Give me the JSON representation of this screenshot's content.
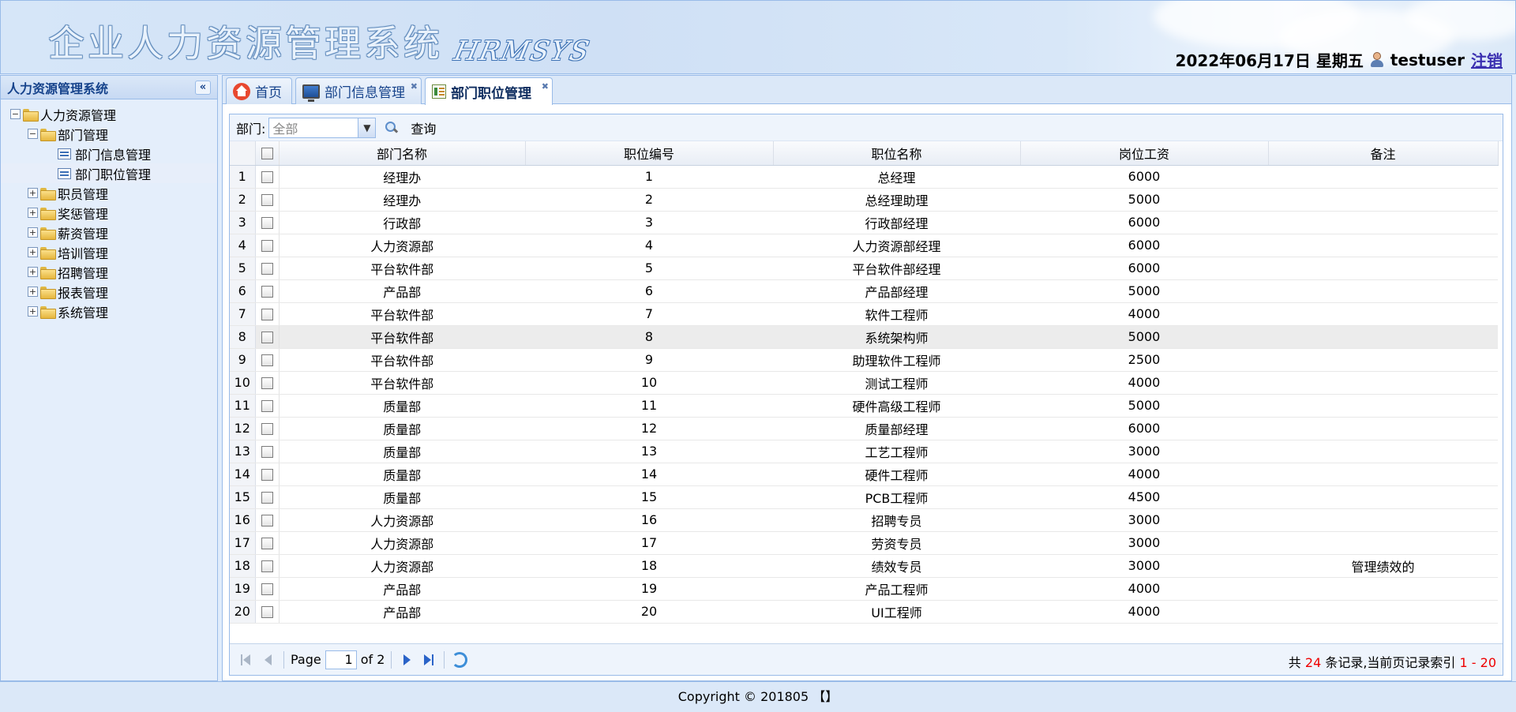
{
  "header": {
    "system_title": "企业人力资源管理系统",
    "system_subtitle": "HRMSYS",
    "date_text": "2022年06月17日 星期五",
    "username": "testuser",
    "logout_label": "注销",
    "user_icon": "user-icon"
  },
  "sidebar": {
    "title": "人力资源管理系统",
    "collapse_icon": "double-chevron-left-icon",
    "root": "人力资源管理",
    "items": [
      {
        "label": "部门管理",
        "expanded": true
      },
      {
        "label": "部门信息管理",
        "child": true
      },
      {
        "label": "部门职位管理",
        "child": true,
        "selected": true
      },
      {
        "label": "职员管理"
      },
      {
        "label": "奖惩管理"
      },
      {
        "label": "薪资管理"
      },
      {
        "label": "培训管理"
      },
      {
        "label": "招聘管理"
      },
      {
        "label": "报表管理"
      },
      {
        "label": "系统管理"
      }
    ]
  },
  "tabs": [
    {
      "label": "首页",
      "icon": "home-icon",
      "closable": false
    },
    {
      "label": "部门信息管理",
      "icon": "monitor-icon",
      "closable": true
    },
    {
      "label": "部门职位管理",
      "icon": "grid-icon",
      "closable": true,
      "active": true
    }
  ],
  "toolbar": {
    "dept_label": "部门:",
    "dept_value": "全部",
    "query_label": "查询"
  },
  "table": {
    "columns": [
      "部门名称",
      "职位编号",
      "职位名称",
      "岗位工资",
      "备注"
    ],
    "rows": [
      {
        "n": "1",
        "dept": "经理办",
        "id": "1",
        "name": "总经理",
        "salary": "6000",
        "note": ""
      },
      {
        "n": "2",
        "dept": "经理办",
        "id": "2",
        "name": "总经理助理",
        "salary": "5000",
        "note": ""
      },
      {
        "n": "3",
        "dept": "行政部",
        "id": "3",
        "name": "行政部经理",
        "salary": "6000",
        "note": ""
      },
      {
        "n": "4",
        "dept": "人力资源部",
        "id": "4",
        "name": "人力资源部经理",
        "salary": "6000",
        "note": ""
      },
      {
        "n": "5",
        "dept": "平台软件部",
        "id": "5",
        "name": "平台软件部经理",
        "salary": "6000",
        "note": ""
      },
      {
        "n": "6",
        "dept": "产品部",
        "id": "6",
        "name": "产品部经理",
        "salary": "5000",
        "note": ""
      },
      {
        "n": "7",
        "dept": "平台软件部",
        "id": "7",
        "name": "软件工程师",
        "salary": "4000",
        "note": ""
      },
      {
        "n": "8",
        "dept": "平台软件部",
        "id": "8",
        "name": "系统架构师",
        "salary": "5000",
        "note": ""
      },
      {
        "n": "9",
        "dept": "平台软件部",
        "id": "9",
        "name": "助理软件工程师",
        "salary": "2500",
        "note": ""
      },
      {
        "n": "10",
        "dept": "平台软件部",
        "id": "10",
        "name": "测试工程师",
        "salary": "4000",
        "note": ""
      },
      {
        "n": "11",
        "dept": "质量部",
        "id": "11",
        "name": "硬件高级工程师",
        "salary": "5000",
        "note": ""
      },
      {
        "n": "12",
        "dept": "质量部",
        "id": "12",
        "name": "质量部经理",
        "salary": "6000",
        "note": ""
      },
      {
        "n": "13",
        "dept": "质量部",
        "id": "13",
        "name": "工艺工程师",
        "salary": "3000",
        "note": ""
      },
      {
        "n": "14",
        "dept": "质量部",
        "id": "14",
        "name": "硬件工程师",
        "salary": "4000",
        "note": ""
      },
      {
        "n": "15",
        "dept": "质量部",
        "id": "15",
        "name": "PCB工程师",
        "salary": "4500",
        "note": ""
      },
      {
        "n": "16",
        "dept": "人力资源部",
        "id": "16",
        "name": "招聘专员",
        "salary": "3000",
        "note": ""
      },
      {
        "n": "17",
        "dept": "人力资源部",
        "id": "17",
        "name": "劳资专员",
        "salary": "3000",
        "note": ""
      },
      {
        "n": "18",
        "dept": "人力资源部",
        "id": "18",
        "name": "绩效专员",
        "salary": "3000",
        "note": "管理绩效的"
      },
      {
        "n": "19",
        "dept": "产品部",
        "id": "19",
        "name": "产品工程师",
        "salary": "4000",
        "note": ""
      },
      {
        "n": "20",
        "dept": "产品部",
        "id": "20",
        "name": "UI工程师",
        "salary": "4000",
        "note": ""
      }
    ]
  },
  "pager": {
    "page_label": "Page",
    "page_value": "1",
    "of_label": "of 2",
    "info_prefix": "共 ",
    "total": "24",
    "info_mid": " 条记录,当前页记录索引 ",
    "range": "1 - 20"
  },
  "footer": {
    "text": "Copyright © 201805 【】"
  },
  "colors": {
    "accent": "#99bbe8",
    "highlight": "#ee0000"
  }
}
